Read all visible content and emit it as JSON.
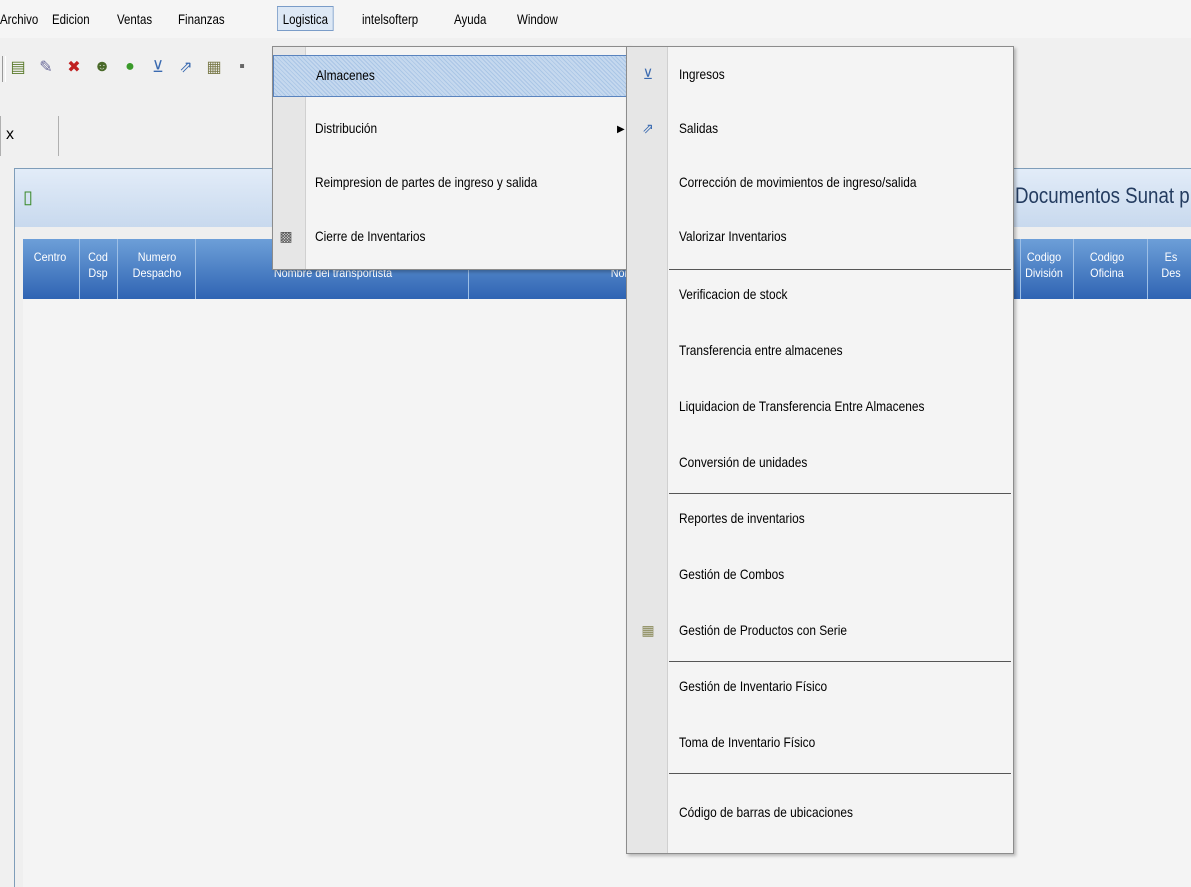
{
  "menubar": {
    "items": [
      "Archivo",
      "Edicion",
      "Ventas",
      "Finanzas",
      "Logistica",
      "intelsofterp",
      "Ayuda",
      "Window"
    ]
  },
  "tab": {
    "close_label": "x"
  },
  "window": {
    "title": "Documentos Sunat p",
    "columns": [
      {
        "label": "Centro"
      },
      {
        "label": "Cod\nDsp"
      },
      {
        "label": "Numero\nDespacho"
      },
      {
        "label": "Nombre del transportista"
      },
      {
        "label": "Nombre del c"
      },
      {
        "label": "Codigo\nDivisión"
      },
      {
        "label": "Codigo\nOficina"
      },
      {
        "label": "Es\nDes"
      }
    ]
  },
  "logistica_menu": {
    "items": [
      {
        "label": "Almacenes"
      },
      {
        "label": "Distribución"
      },
      {
        "label": "Reimpresion de partes de ingreso y salida"
      },
      {
        "label": "Cierre de Inventarios"
      }
    ]
  },
  "almacenes_menu": {
    "items": [
      {
        "label": "Ingresos"
      },
      {
        "label": "Salidas"
      },
      {
        "label": "Corrección de movimientos de ingreso/salida"
      },
      {
        "label": "Valorizar Inventarios"
      },
      {
        "label": "Verificacion de stock"
      },
      {
        "label": "Transferencia entre almacenes"
      },
      {
        "label": "Liquidacion de Transferencia Entre Almacenes"
      },
      {
        "label": "Conversión de unidades"
      },
      {
        "label": "Reportes de inventarios"
      },
      {
        "label": "Gestión de Combos"
      },
      {
        "label": "Gestión de Productos con Serie"
      },
      {
        "label": "Gestión de Inventario Físico"
      },
      {
        "label": "Toma de Inventario Físico"
      },
      {
        "label": "Código de barras de ubicaciones"
      }
    ]
  }
}
